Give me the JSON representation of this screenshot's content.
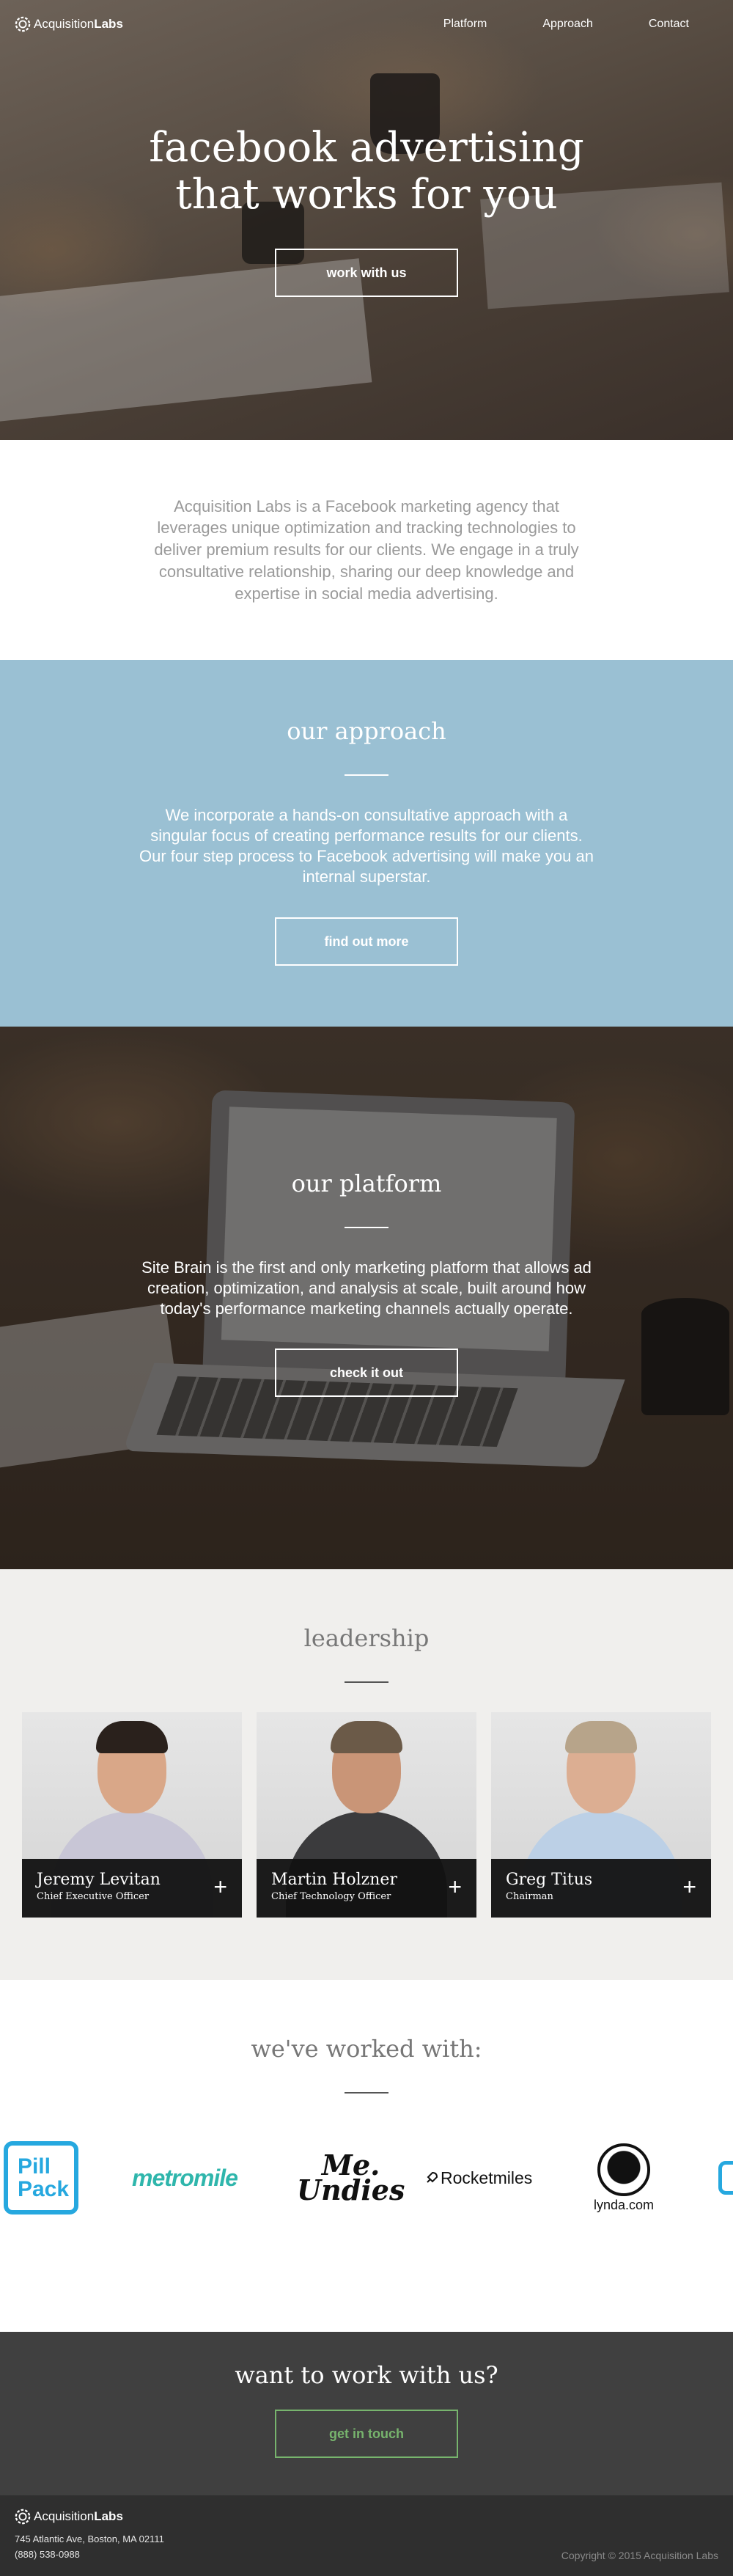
{
  "brand": {
    "name_regular": "Acquisition",
    "name_bold": "Labs"
  },
  "nav": {
    "items": [
      "Platform",
      "Approach",
      "Contact"
    ]
  },
  "hero": {
    "title_line1": "facebook advertising",
    "title_line2": "that works for you",
    "button": "work with us"
  },
  "intro": {
    "text": "Acquisition Labs is a Facebook marketing agency that leverages unique optimization and tracking technologies to deliver premium results for our clients. We engage in a truly consultative relationship, sharing our deep knowledge and expertise in social media advertising."
  },
  "approach": {
    "title": "our approach",
    "text": "We incorporate a hands-on consultative approach with a singular focus of creating performance results for our clients. Our four step process to Facebook advertising will make you an internal superstar.",
    "button": "find out more",
    "background": "#9ac0d3"
  },
  "platform": {
    "title": "our platform",
    "text": "Site Brain is the first and only marketing platform that allows ad creation, optimization, and analysis at scale, built around how today's performance marketing channels actually operate.",
    "button": "check it out"
  },
  "leadership": {
    "title": "leadership",
    "members": [
      {
        "name": "Jeremy Levitan",
        "role": "Chief Executive Officer"
      },
      {
        "name": "Martin Holzner",
        "role": "Chief Technology Officer"
      },
      {
        "name": "Greg Titus",
        "role": "Chairman"
      }
    ]
  },
  "clients": {
    "title": "we've worked with:",
    "logos": {
      "pillpack_line1": "Pill",
      "pillpack_line2": "Pack",
      "metromile": "metromile",
      "meundies_line1": "Me.",
      "meundies_line2": "Undies",
      "rocketmiles": "Rocketmiles",
      "lynda": "lynda.com"
    }
  },
  "cta": {
    "title": "want to work with us?",
    "button": "get in touch",
    "accent": "#77b46d"
  },
  "footer": {
    "address": "745 Atlantic Ave, Boston, MA 02111",
    "phone": "(888) 538-0988",
    "copyright": "Copyright © 2015 Acquisition Labs"
  }
}
